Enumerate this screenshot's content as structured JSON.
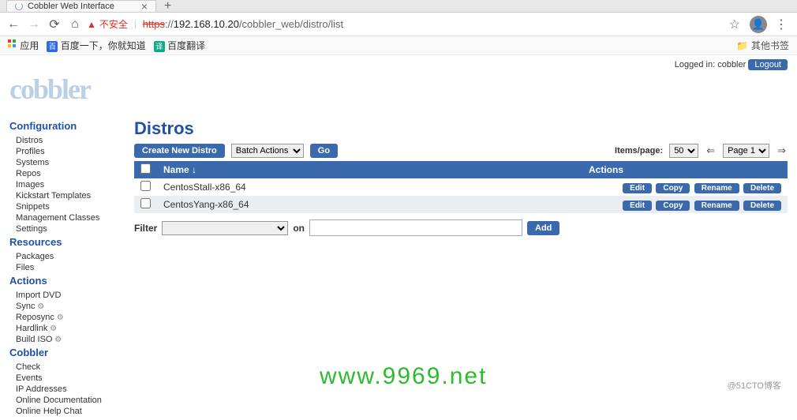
{
  "browser": {
    "tab_title": "Cobbler Web Interface",
    "warning_label": "不安全",
    "url_proto": "https",
    "url_rest": "://",
    "url_host": "192.168.10.20",
    "url_path": "/cobbler_web/distro/list",
    "bookmarks": {
      "apps": "应用",
      "baidu": "百度一下，你就知道",
      "trans": "百度翻译",
      "other": "其他书签"
    }
  },
  "header": {
    "logged_in_label": "Logged in:",
    "user": "cobbler",
    "logout": "Logout",
    "logo": "cobbler"
  },
  "sidebar": {
    "configuration": {
      "title": "Configuration",
      "items": [
        "Distros",
        "Profiles",
        "Systems",
        "Repos",
        "Images",
        "Kickstart Templates",
        "Snippets",
        "Management Classes",
        "Settings"
      ]
    },
    "resources": {
      "title": "Resources",
      "items": [
        "Packages",
        "Files"
      ]
    },
    "actions": {
      "title": "Actions",
      "items": [
        "Import DVD",
        "Sync",
        "Reposync",
        "Hardlink",
        "Build ISO"
      ]
    },
    "cobbler": {
      "title": "Cobbler",
      "items": [
        "Check",
        "Events",
        "IP Addresses",
        "Online Documentation",
        "Online Help Chat"
      ]
    }
  },
  "main": {
    "title": "Distros",
    "create_btn": "Create New Distro",
    "batch_label": "Batch Actions",
    "go_btn": "Go",
    "items_label": "Items/page:",
    "items_value": "50",
    "page_label": "Page 1",
    "col_name": "Name ↓",
    "col_actions": "Actions",
    "rows": [
      {
        "name": "CentosStall-x86_64"
      },
      {
        "name": "CentosYang-x86_64"
      }
    ],
    "action_btns": [
      "Edit",
      "Copy",
      "Rename",
      "Delete"
    ],
    "filter_label": "Filter",
    "on_label": "on",
    "add_btn": "Add"
  },
  "watermark": "www.9969.net",
  "credit": "@51CTO博客"
}
